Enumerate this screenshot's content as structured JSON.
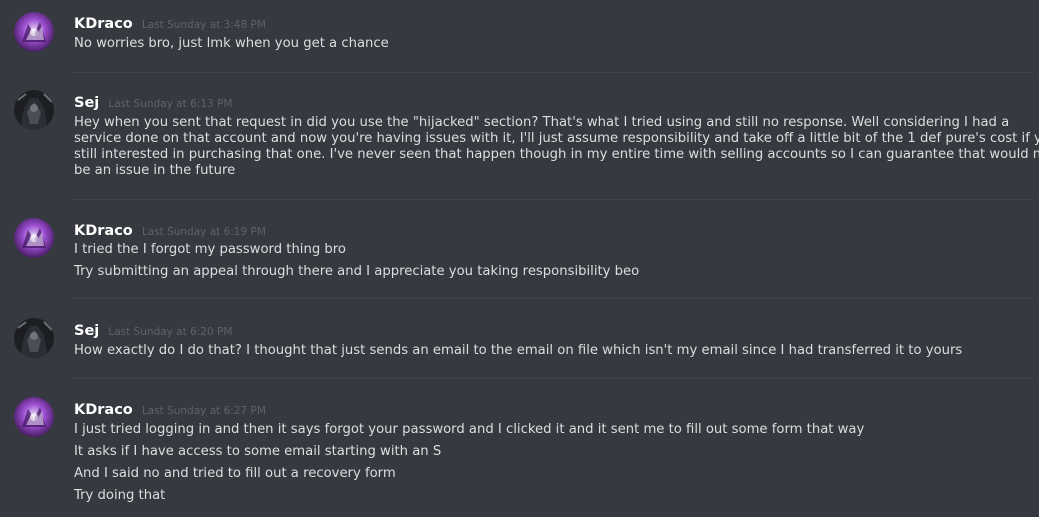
{
  "messages": [
    {
      "username": "KDraco",
      "avatar_icon": "purple-dragon-avatar-icon",
      "timestamp": "Last Sunday at 3:48 PM",
      "lines": [
        "No worries bro, just lmk when you get a chance"
      ]
    },
    {
      "username": "Sej",
      "avatar_icon": "dark-character-avatar-icon",
      "timestamp": "Last Sunday at 6:13 PM",
      "lines": [
        "Hey when you sent that request in did you use the \"hijacked\" section? That's what I tried using and still no response. Well considering I had a",
        "service done on that account and now you're having issues with it, I'll just assume responsibility and take off a little bit of the 1 def pure's cost if you're",
        "still interested in purchasing that one. I've never seen that happen though in my entire time with selling accounts so I can guarantee that would never",
        "be an issue in the future"
      ]
    },
    {
      "username": "KDraco",
      "avatar_icon": "purple-dragon-avatar-icon",
      "timestamp": "Last Sunday at 6:19 PM",
      "lines": [
        "I tried the I forgot my password thing bro",
        "Try submitting an appeal through there and I appreciate you taking responsibility beo"
      ]
    },
    {
      "username": "Sej",
      "avatar_icon": "dark-character-avatar-icon",
      "timestamp": "Last Sunday at 6:20 PM",
      "lines": [
        "How exactly do I do that? I thought that just sends an email to the email on file which isn't my email since I had transferred it to yours"
      ]
    },
    {
      "username": "KDraco",
      "avatar_icon": "purple-dragon-avatar-icon",
      "timestamp": "Last Sunday at 6:27 PM",
      "lines": [
        "I just tried logging in and then it says forgot your password and I clicked it and it sent me to fill out some form that way",
        "It asks if I have access to some email starting with an S",
        "And I said no and tried to fill out a recovery form",
        "Try doing that"
      ]
    }
  ],
  "colors": {
    "background": "#36393f",
    "username": "#ffffff",
    "timestamp": "#5f6267",
    "message_text": "#dcddde",
    "divider": "#42454a"
  }
}
